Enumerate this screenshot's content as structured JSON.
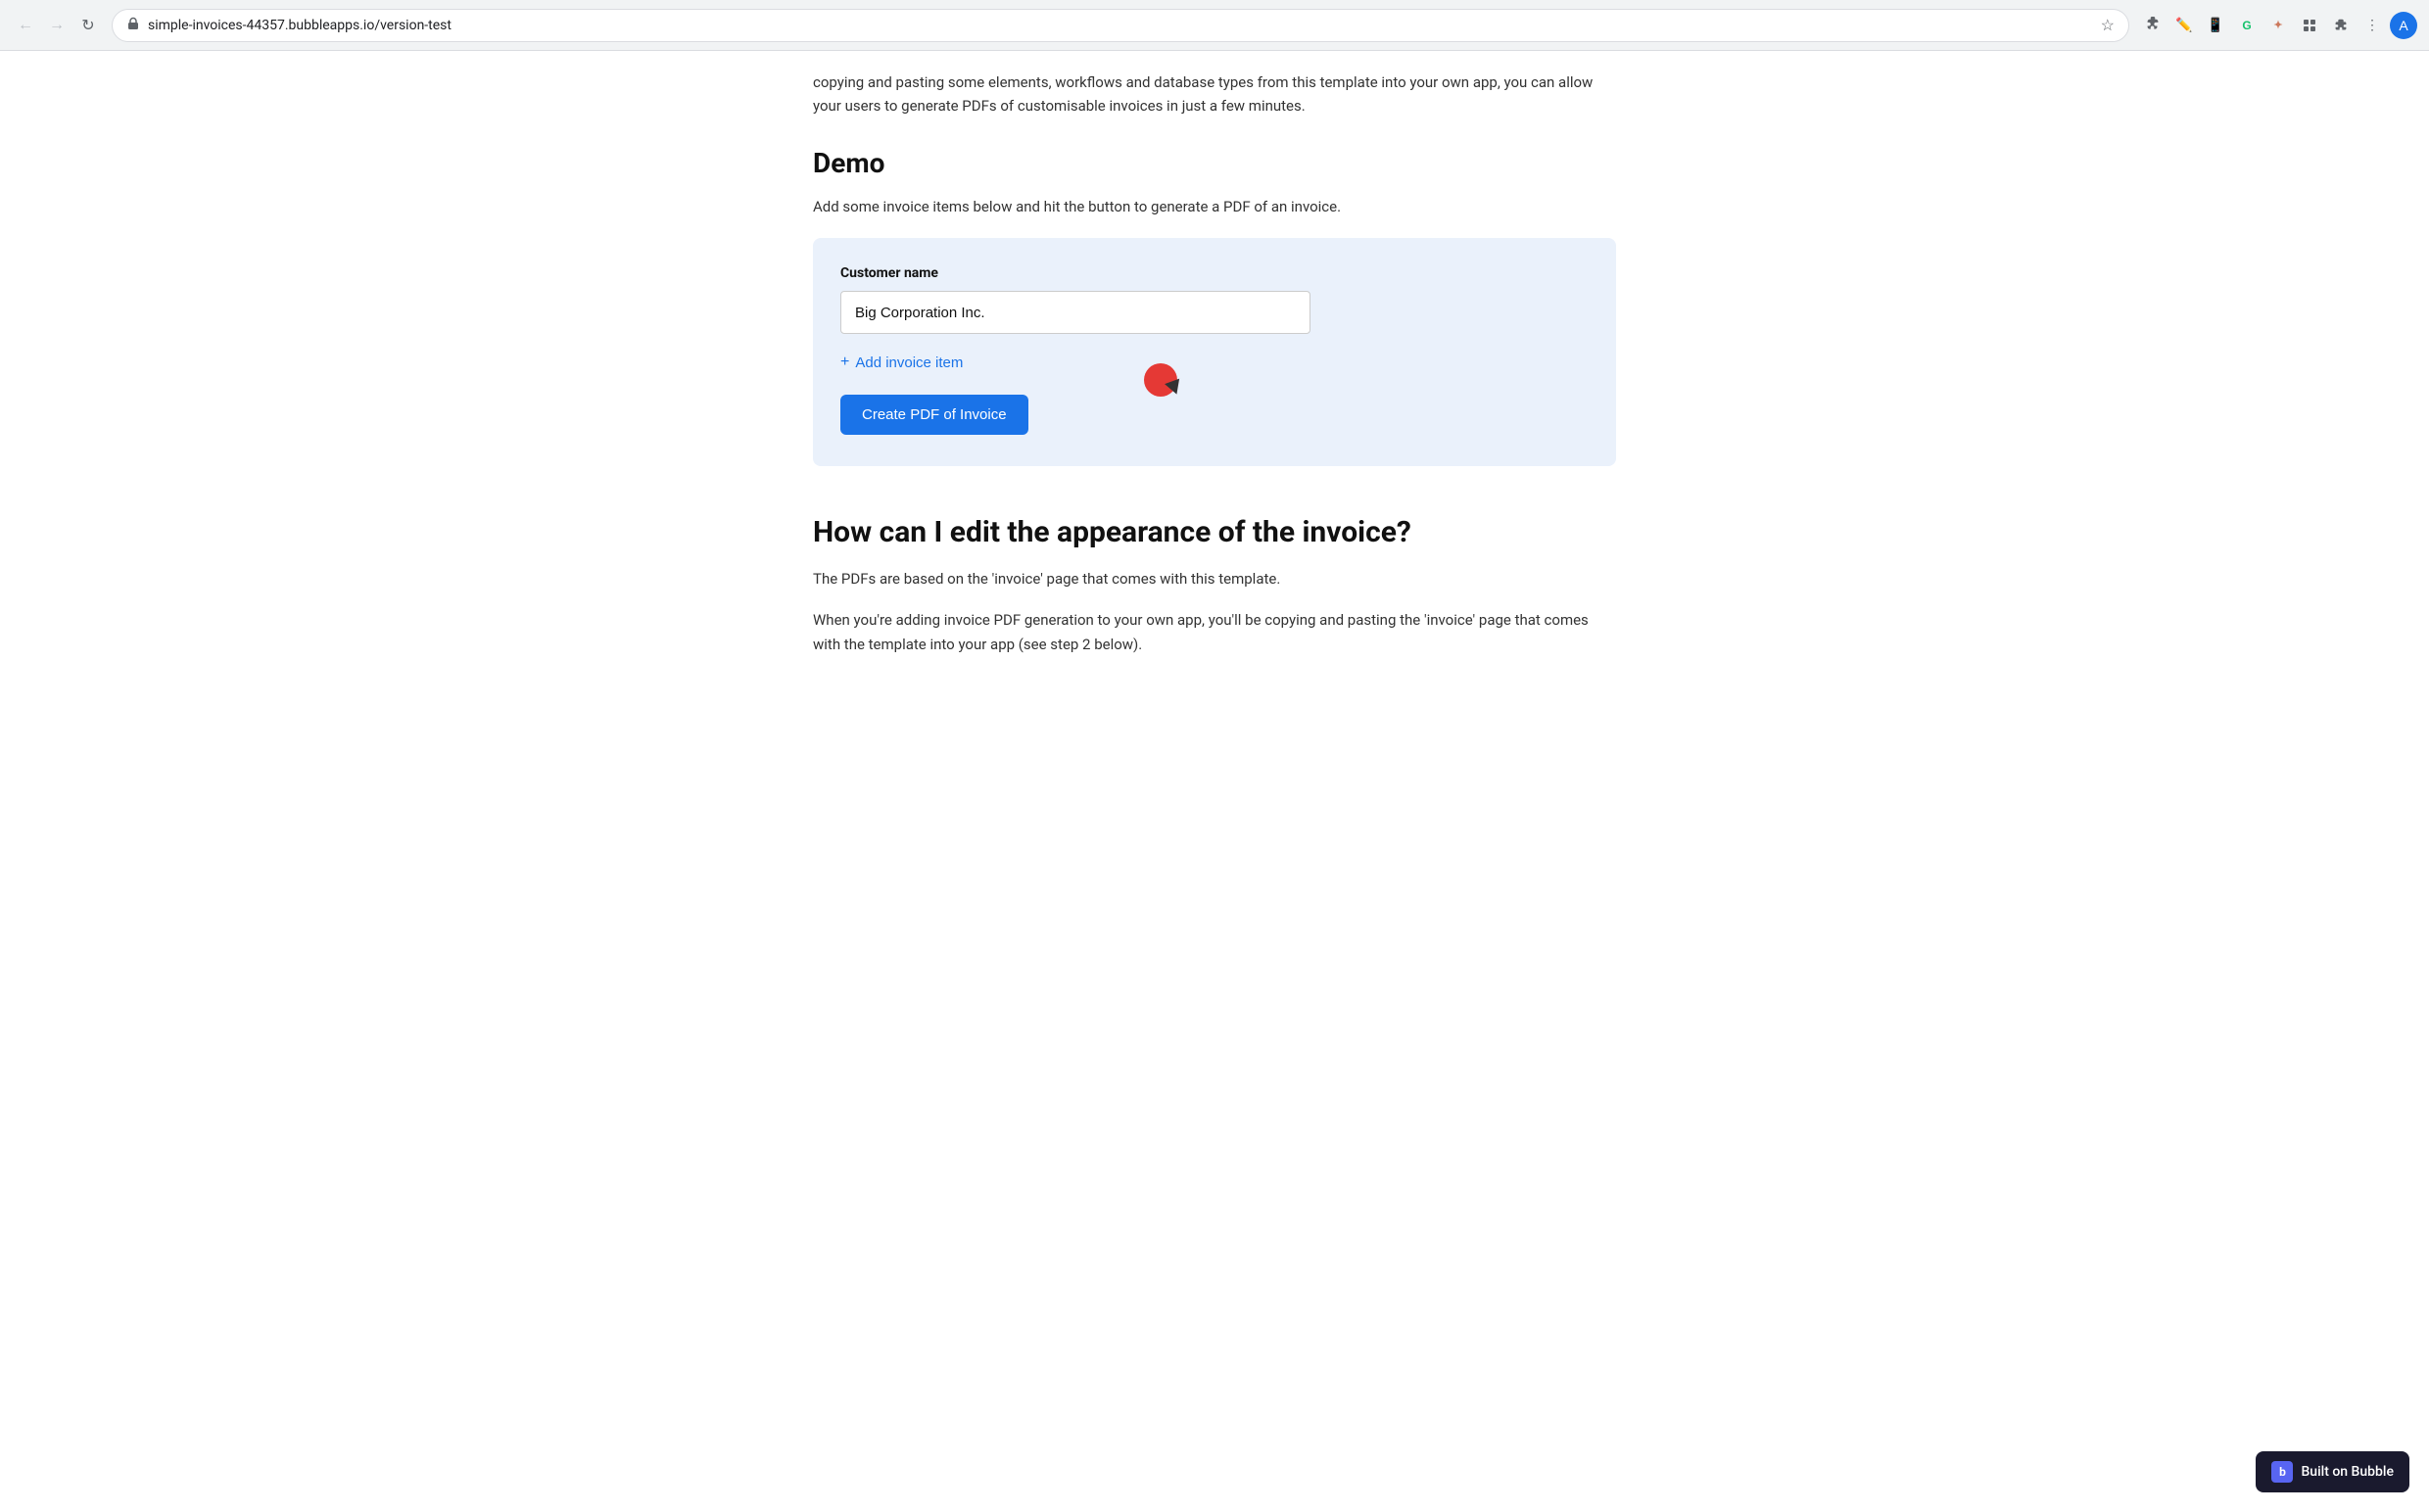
{
  "browser": {
    "url": "simple-invoices-44357.bubbleapps.io/version-test",
    "back_disabled": true,
    "forward_disabled": true
  },
  "intro_text": "copying and pasting some elements, workflows and database types from this template into your own app, you can allow your users to generate PDFs of customisable invoices in just a few minutes.",
  "demo_section": {
    "title": "Demo",
    "description": "Add some invoice items below and hit the button to generate a PDF of an invoice.",
    "field_label": "Customer name",
    "customer_name_value": "Big Corporation Inc.",
    "add_invoice_label": "Add invoice item",
    "create_pdf_label": "Create PDF of Invoice"
  },
  "edit_section": {
    "title": "How can I edit the appearance of the invoice?",
    "text1": "The PDFs are based on the 'invoice' page that comes with this template.",
    "text2": "When you're adding invoice PDF generation to your own app, you'll be copying and pasting the 'invoice' page that comes with the template into your app (see step 2 below)."
  },
  "built_on_bubble": {
    "label": "Built on Bubble"
  }
}
